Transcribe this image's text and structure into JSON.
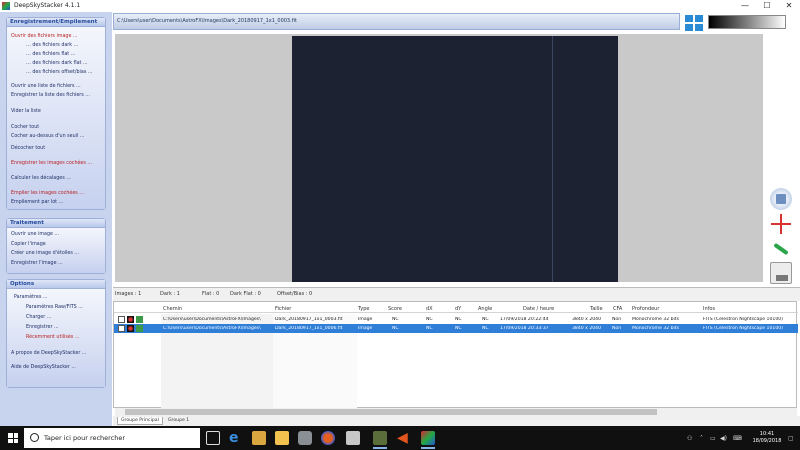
{
  "window": {
    "title": "DeepSkyStacker 4.1.1",
    "minimize": "—",
    "maximize": "☐",
    "close": "✕"
  },
  "left_panel": {
    "groups": [
      {
        "title": "Enregistrement/Empilement",
        "items": [
          {
            "label": "Ouvrir des fichiers image ...",
            "red": true
          },
          {
            "label": "… des fichiers dark ..."
          },
          {
            "label": "… des fichiers flat ..."
          },
          {
            "label": "… des fichiers dark flat ..."
          },
          {
            "label": "… des fichiers offset/bias ..."
          },
          {
            "label": "Ouvrir une liste de fichiers ..."
          },
          {
            "label": "Enregistrer la liste des fichiers ..."
          },
          {
            "label": "Vider la liste"
          },
          {
            "label": "Cocher tout"
          },
          {
            "label": "Cocher au-dessus d'un seuil ..."
          },
          {
            "label": "Décocher tout"
          },
          {
            "label": "Enregistrer les images cochées ...",
            "red": true
          },
          {
            "label": "Calculer les décalages ..."
          },
          {
            "label": "Empiler les images cochées ...",
            "red": true
          },
          {
            "label": "Empilement par lot ..."
          }
        ]
      },
      {
        "title": "Traitement",
        "items": [
          {
            "label": "Ouvrir une image ..."
          },
          {
            "label": "Copier l'image"
          },
          {
            "label": "Créer une image d'étoiles ..."
          },
          {
            "label": "Enregistrer l'image ..."
          }
        ]
      },
      {
        "title": "Options",
        "items": [
          {
            "label": "Paramètres ..."
          },
          {
            "label": "Paramètres Raw/FITS ..."
          },
          {
            "label": "Charger ..."
          },
          {
            "label": "Enregistrer ..."
          },
          {
            "label": "Récemment utilisés ...",
            "red": true
          },
          {
            "label": "A propos de DeepSkyStacker ..."
          },
          {
            "label": "Aide de DeepSkyStacker ..."
          }
        ]
      }
    ]
  },
  "path_bar": {
    "path": "C:\\Users\\user\\Documents\\AstroFX\\Images\\Dark_20180917_1x1_0003.fit"
  },
  "stats": [
    {
      "label": "Images : 1"
    },
    {
      "label": "Dark : 1"
    },
    {
      "label": "Flat : 0"
    },
    {
      "label": "Dark Flat : 0"
    },
    {
      "label": "Offset/Bias : 0"
    }
  ],
  "table": {
    "headers": [
      "Chemin",
      "Fichier",
      "Type",
      "Score",
      "dX",
      "dY",
      "Angle",
      "Date / heure",
      "Taille",
      "CFA",
      "Profondeur",
      "Infos"
    ],
    "rows": [
      {
        "selected": false,
        "cells": [
          "C:\\Users\\user\\Documents\\AstroFX\\Images\\",
          "Dark_20180917_1x1_0003.fit",
          "Image",
          "NC",
          "NC",
          "NC",
          "NC",
          "17/09/2018 20:22:44",
          "3840 x 2040",
          "Non",
          "Monochrome 32 bits",
          "FITS (Celestron Nightscape 10100)"
        ]
      },
      {
        "selected": true,
        "cells": [
          "C:\\Users\\user\\Documents\\AstroFX\\Images\\",
          "Dark_20180917_1x1_0006.fit",
          "Image",
          "NC",
          "NC",
          "NC",
          "NC",
          "17/09/2018 20:33:37",
          "3840 x 2040",
          "Non",
          "Monochrome 32 bits",
          "FITS (Celestron Nightscape 10100)"
        ]
      }
    ]
  },
  "tabs": [
    "Groupe Principal",
    "Groupe 1"
  ],
  "taskbar": {
    "search_placeholder": "Taper ici pour rechercher",
    "time": "10:41",
    "date": "18/09/2018"
  },
  "colors": {
    "accent": "#2f7ed8",
    "panel": "#c8d3ee",
    "taskbar": "#101010"
  }
}
